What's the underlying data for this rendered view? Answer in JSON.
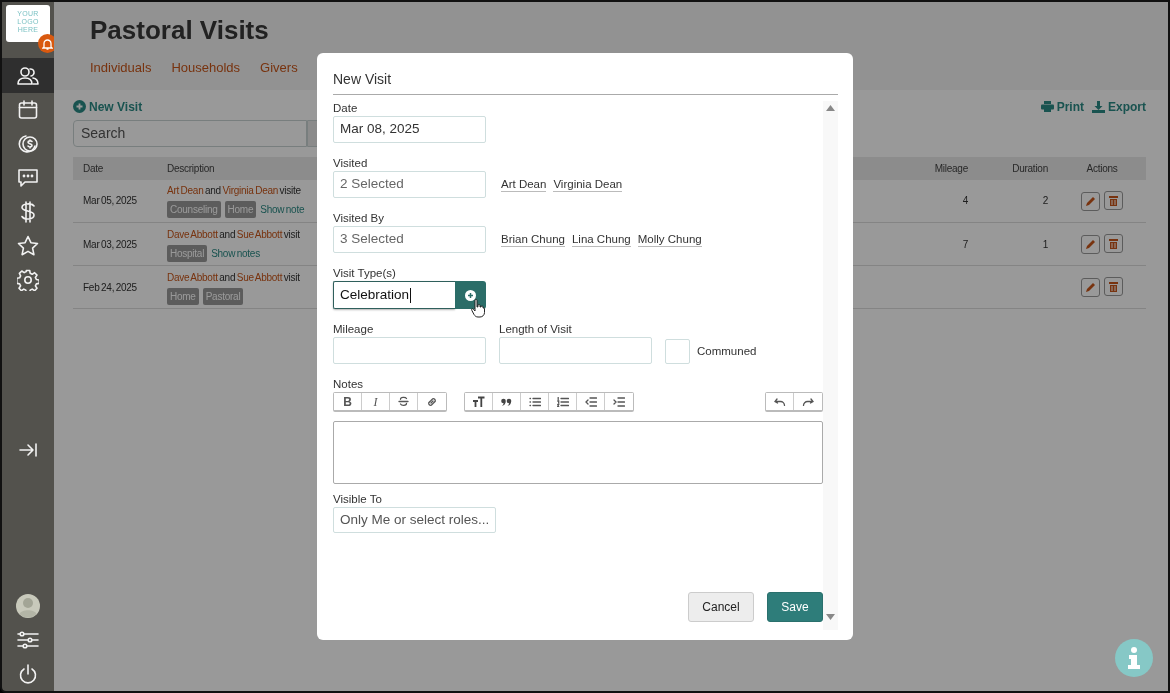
{
  "sidebar": {
    "logo_text": "YOUR LOGO HERE",
    "items": [
      {
        "kind": "people",
        "selected": true
      },
      {
        "kind": "calendar",
        "selected": false
      },
      {
        "kind": "coin",
        "selected": false
      },
      {
        "kind": "chat",
        "selected": false
      },
      {
        "kind": "dollar",
        "selected": false
      },
      {
        "kind": "star",
        "selected": false
      },
      {
        "kind": "gear",
        "selected": false
      }
    ],
    "bottom_items": [
      {
        "kind": "collapse"
      },
      {
        "kind": "avatar"
      },
      {
        "kind": "sliders"
      },
      {
        "kind": "power"
      }
    ]
  },
  "page": {
    "title": "Pastoral Visits",
    "tabs": [
      "Individuals",
      "Households",
      "Givers"
    ],
    "new_visit": "New Visit",
    "print": "Print",
    "export": "Export",
    "search": {
      "placeholder": "Search"
    },
    "table": {
      "columns": [
        "Date",
        "Description",
        "Mileage",
        "Duration",
        "Actions"
      ],
      "rows": [
        {
          "date": "Mar 05, 2025",
          "description": [
            {
              "kind": "person",
              "text": "Art Dean"
            },
            {
              "kind": "text",
              "text": "and"
            },
            {
              "kind": "person",
              "text": "Virginia Dean"
            },
            {
              "kind": "text",
              "text": "visite"
            }
          ],
          "tags": [
            "Counseling",
            "Home"
          ],
          "show_notes": "Show note",
          "mileage": "4",
          "duration": "2"
        },
        {
          "date": "Mar 03, 2025",
          "description": [
            {
              "kind": "person",
              "text": "Dave Abbott"
            },
            {
              "kind": "text",
              "text": "and"
            },
            {
              "kind": "person",
              "text": "Sue Abbott"
            },
            {
              "kind": "text",
              "text": "visit"
            }
          ],
          "tags": [
            "Hospital"
          ],
          "show_notes": "Show notes",
          "mileage": "7",
          "duration": "1"
        },
        {
          "date": "Feb 24, 2025",
          "description": [
            {
              "kind": "person",
              "text": "Dave Abbott"
            },
            {
              "kind": "text",
              "text": "and"
            },
            {
              "kind": "person",
              "text": "Sue Abbott"
            },
            {
              "kind": "text",
              "text": "visit"
            }
          ],
          "tags": [
            "Home",
            "Pastoral"
          ]
        }
      ]
    }
  },
  "modal": {
    "title": "New Visit",
    "date": {
      "label": "Date",
      "value": "Mar 08, 2025"
    },
    "visited": {
      "label": "Visited",
      "value": "2 Selected",
      "chips": [
        "Art Dean",
        "Virginia Dean"
      ]
    },
    "visited_by": {
      "label": "Visited By",
      "value": "3 Selected",
      "chips": [
        "Brian Chung",
        "Lina Chung",
        "Molly Chung"
      ]
    },
    "visit_types": {
      "label": "Visit Type(s)",
      "value": "Celebration",
      "focused": true
    },
    "mileage": {
      "label": "Mileage"
    },
    "length": {
      "label": "Length of Visit"
    },
    "communed": {
      "label": "Communed",
      "checked": false
    },
    "notes": {
      "label": "Notes",
      "toolbar": [
        [
          {
            "kind": "bold",
            "label": "B"
          },
          {
            "kind": "italic",
            "label": "I"
          },
          {
            "kind": "strike"
          },
          {
            "kind": "link"
          }
        ],
        [
          {
            "kind": "size"
          },
          {
            "kind": "quote"
          },
          {
            "kind": "bullets"
          },
          {
            "kind": "numbers"
          },
          {
            "kind": "outdent"
          },
          {
            "kind": "indent"
          }
        ],
        [
          {
            "kind": "undo"
          },
          {
            "kind": "redo"
          }
        ]
      ]
    },
    "visible_to": {
      "label": "Visible To",
      "placeholder": "Only Me or select roles..."
    },
    "cancel": "Cancel",
    "save": "Save"
  }
}
